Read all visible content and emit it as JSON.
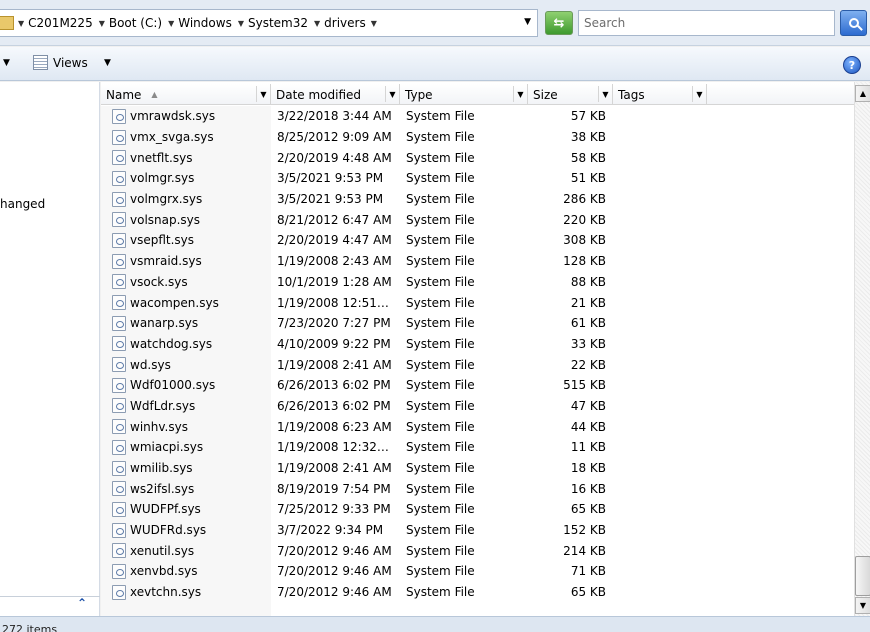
{
  "address": {
    "crumbs": [
      "C201M225",
      "Boot (C:)",
      "Windows",
      "System32",
      "drivers"
    ],
    "search_placeholder": "Search"
  },
  "toolbar": {
    "views_label": "Views"
  },
  "navpane": {
    "partial_text": "hanged"
  },
  "columns": {
    "name": "Name",
    "date": "Date modified",
    "type": "Type",
    "size": "Size",
    "tags": "Tags"
  },
  "files": [
    {
      "name": "vmrawdsk.sys",
      "date": "3/22/2018 3:44 AM",
      "type": "System File",
      "size": "57 KB"
    },
    {
      "name": "vmx_svga.sys",
      "date": "8/25/2012 9:09 AM",
      "type": "System File",
      "size": "38 KB"
    },
    {
      "name": "vnetflt.sys",
      "date": "2/20/2019 4:48 AM",
      "type": "System File",
      "size": "58 KB"
    },
    {
      "name": "volmgr.sys",
      "date": "3/5/2021 9:53 PM",
      "type": "System File",
      "size": "51 KB"
    },
    {
      "name": "volmgrx.sys",
      "date": "3/5/2021 9:53 PM",
      "type": "System File",
      "size": "286 KB"
    },
    {
      "name": "volsnap.sys",
      "date": "8/21/2012 6:47 AM",
      "type": "System File",
      "size": "220 KB"
    },
    {
      "name": "vsepflt.sys",
      "date": "2/20/2019 4:47 AM",
      "type": "System File",
      "size": "308 KB"
    },
    {
      "name": "vsmraid.sys",
      "date": "1/19/2008 2:43 AM",
      "type": "System File",
      "size": "128 KB"
    },
    {
      "name": "vsock.sys",
      "date": "10/1/2019 1:28 AM",
      "type": "System File",
      "size": "88 KB"
    },
    {
      "name": "wacompen.sys",
      "date": "1/19/2008 12:51…",
      "type": "System File",
      "size": "21 KB"
    },
    {
      "name": "wanarp.sys",
      "date": "7/23/2020 7:27 PM",
      "type": "System File",
      "size": "61 KB"
    },
    {
      "name": "watchdog.sys",
      "date": "4/10/2009 9:22 PM",
      "type": "System File",
      "size": "33 KB"
    },
    {
      "name": "wd.sys",
      "date": "1/19/2008 2:41 AM",
      "type": "System File",
      "size": "22 KB"
    },
    {
      "name": "Wdf01000.sys",
      "date": "6/26/2013 6:02 PM",
      "type": "System File",
      "size": "515 KB"
    },
    {
      "name": "WdfLdr.sys",
      "date": "6/26/2013 6:02 PM",
      "type": "System File",
      "size": "47 KB"
    },
    {
      "name": "winhv.sys",
      "date": "1/19/2008 6:23 AM",
      "type": "System File",
      "size": "44 KB"
    },
    {
      "name": "wmiacpi.sys",
      "date": "1/19/2008 12:32…",
      "type": "System File",
      "size": "11 KB"
    },
    {
      "name": "wmilib.sys",
      "date": "1/19/2008 2:41 AM",
      "type": "System File",
      "size": "18 KB"
    },
    {
      "name": "ws2ifsl.sys",
      "date": "8/19/2019 7:54 PM",
      "type": "System File",
      "size": "16 KB"
    },
    {
      "name": "WUDFPf.sys",
      "date": "7/25/2012 9:33 PM",
      "type": "System File",
      "size": "65 KB"
    },
    {
      "name": "WUDFRd.sys",
      "date": "3/7/2022 9:34 PM",
      "type": "System File",
      "size": "152 KB"
    },
    {
      "name": "xenutil.sys",
      "date": "7/20/2012 9:46 AM",
      "type": "System File",
      "size": "214 KB"
    },
    {
      "name": "xenvbd.sys",
      "date": "7/20/2012 9:46 AM",
      "type": "System File",
      "size": "71 KB"
    },
    {
      "name": "xevtchn.sys",
      "date": "7/20/2012 9:46 AM",
      "type": "System File",
      "size": "65 KB"
    }
  ],
  "status": {
    "text": "272 items"
  },
  "colors": {
    "window_bg": "#f0f0f0",
    "address_bg": "#e4ebf4",
    "accent_blue": "#2d6bd0",
    "refresh_green": "#3e9a2e"
  }
}
